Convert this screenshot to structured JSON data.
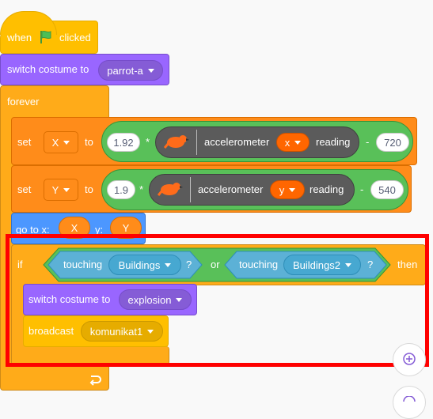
{
  "hat": {
    "when": "when",
    "clicked": "clicked"
  },
  "switch_costume_1": {
    "label": "switch costume to",
    "value": "parrot-a"
  },
  "forever": {
    "label": "forever"
  },
  "set_x": {
    "set": "set",
    "var": "X",
    "to": "to",
    "num": "1.92",
    "times": "*",
    "ext_label": "accelerometer",
    "axis": "x",
    "reading": "reading",
    "minus": "-",
    "sub": "720"
  },
  "set_y": {
    "set": "set",
    "var": "Y",
    "to": "to",
    "num": "1.9",
    "times": "*",
    "ext_label": "accelerometer",
    "axis": "y",
    "reading": "reading",
    "minus": "-",
    "sub": "540"
  },
  "goto": {
    "label": "go to x:",
    "x": "X",
    "y_label": "y:",
    "y": "Y"
  },
  "if_block": {
    "if": "if",
    "touching1": "touching",
    "target1": "Buildings",
    "q1": "?",
    "or": "or",
    "touching2": "touching",
    "target2": "Buildings2",
    "q2": "?",
    "then": "then"
  },
  "switch_costume_2": {
    "label": "switch costume to",
    "value": "explosion"
  },
  "broadcast": {
    "label": "broadcast",
    "value": "komunikat1"
  },
  "colors": {
    "highlight": "#ff0000"
  }
}
